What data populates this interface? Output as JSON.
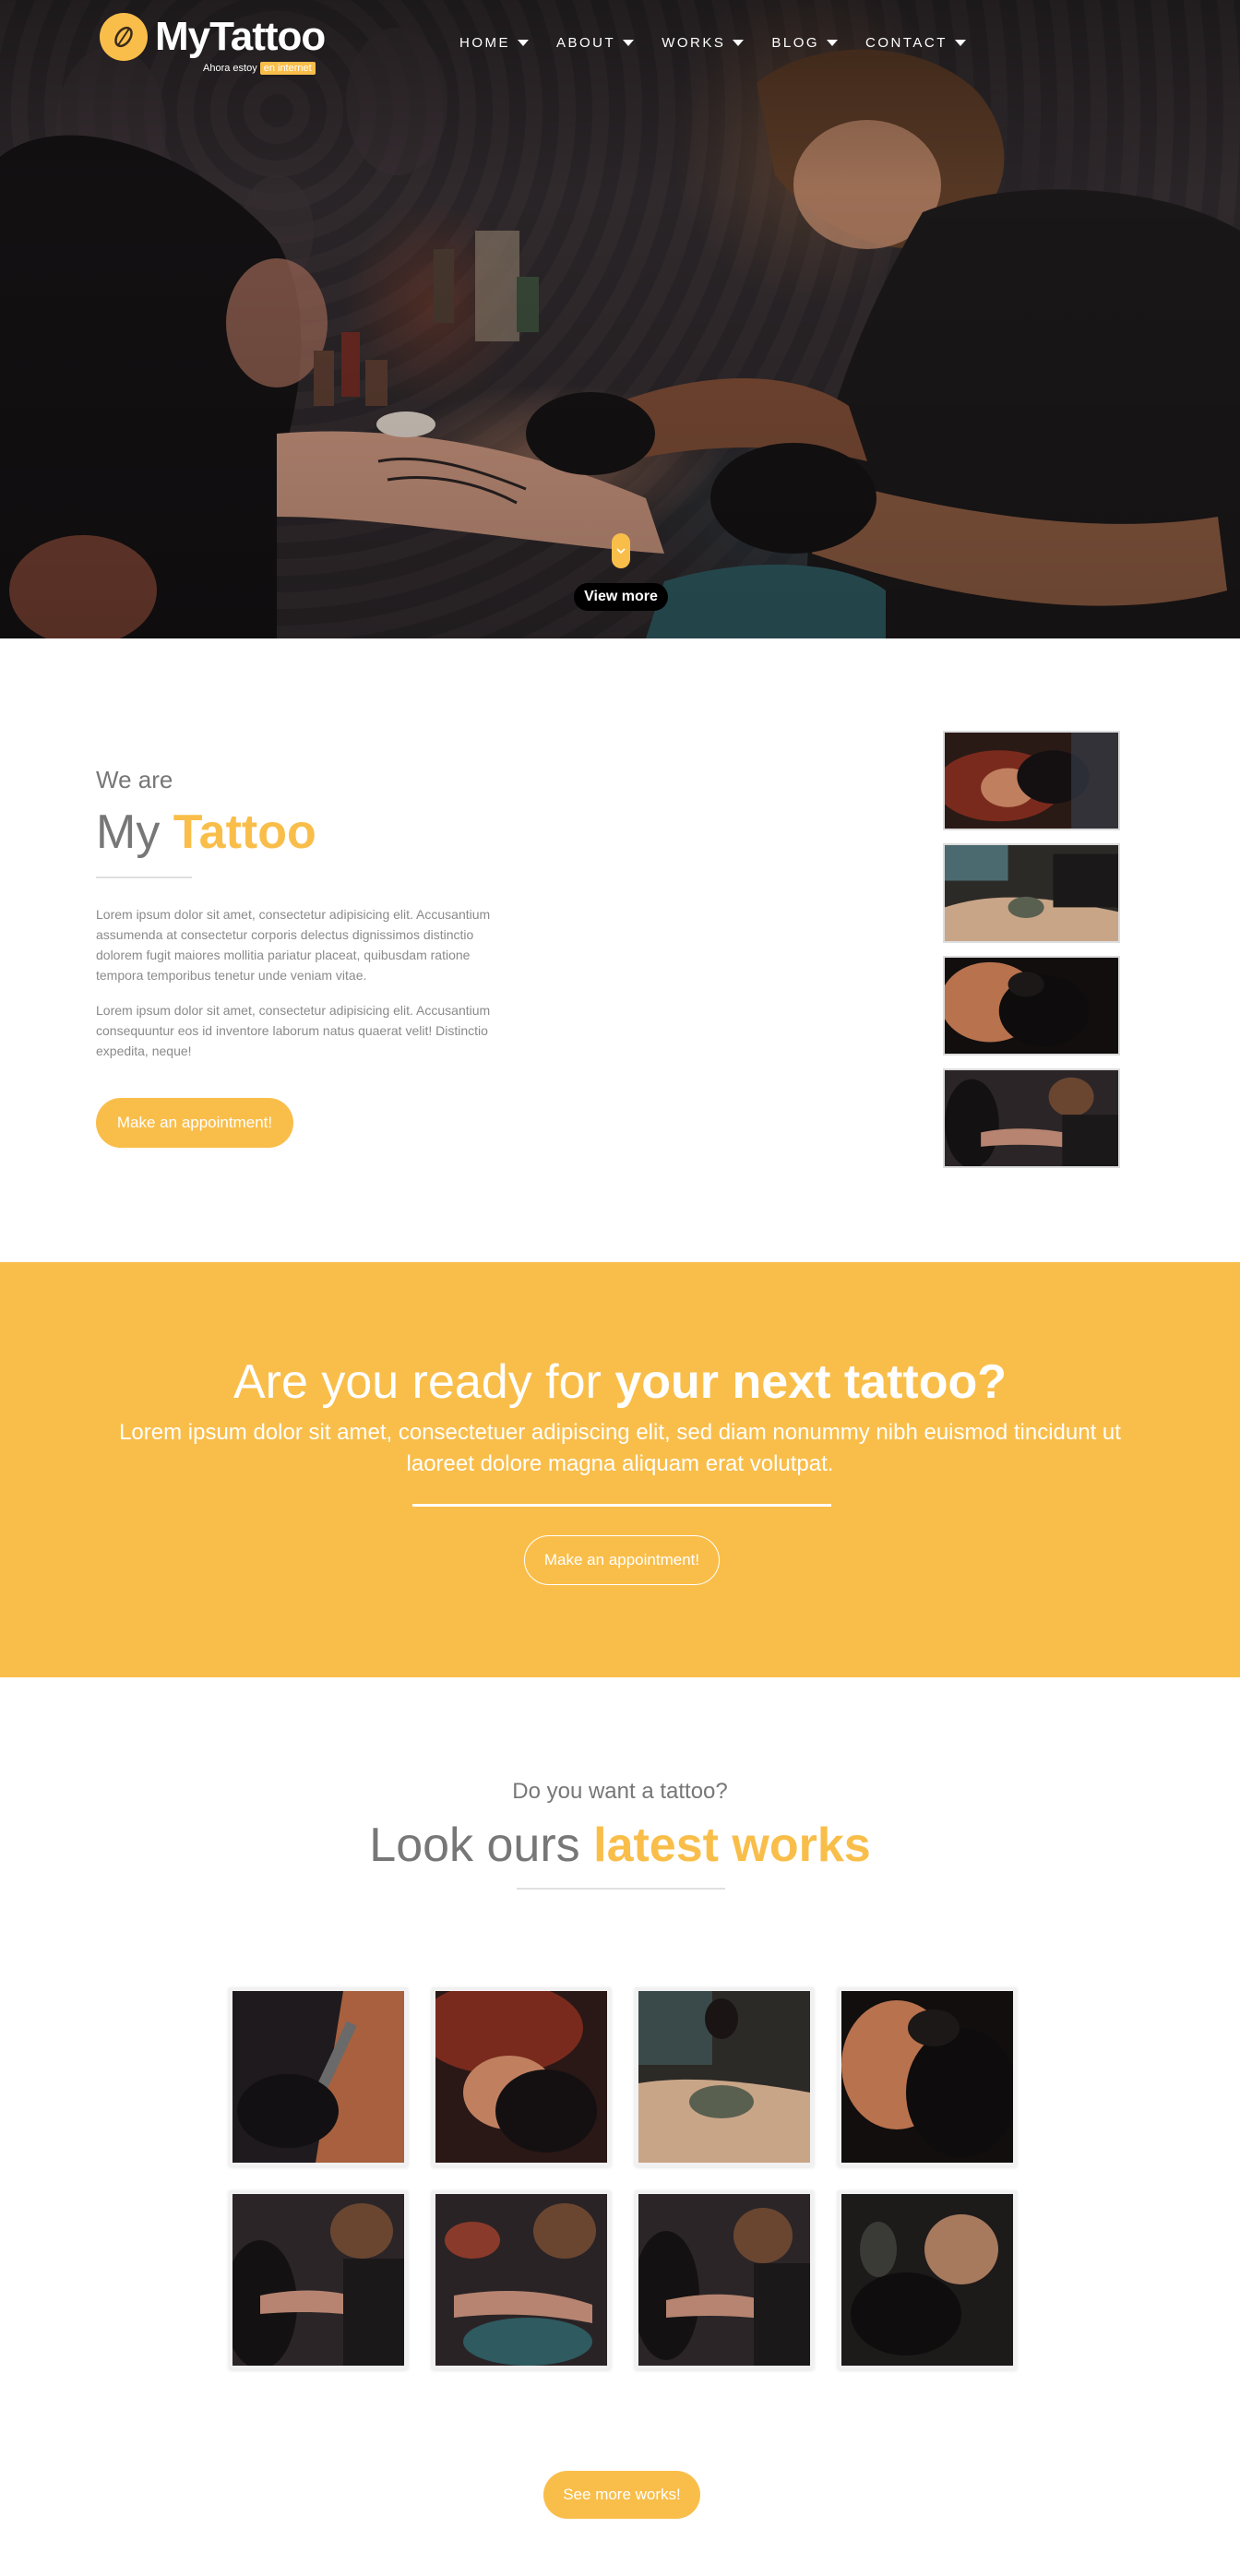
{
  "brand": {
    "name": "MyTattoo",
    "tagline_prefix": "Ahora estoy",
    "tagline_highlight": "en internet",
    "accent": "#f9be4a"
  },
  "nav": {
    "items": [
      {
        "label": "HOME"
      },
      {
        "label": "ABOUT"
      },
      {
        "label": "WORKS"
      },
      {
        "label": "BLOG"
      },
      {
        "label": "CONTACT"
      }
    ]
  },
  "hero": {
    "view_more": "View more",
    "scroll_icon": "chevron-down-icon"
  },
  "about": {
    "kicker": "We are",
    "title_plain": "My",
    "title_accent": "Tattoo",
    "paragraphs": [
      "Lorem ipsum dolor sit amet, consectetur adipisicing elit. Accusantium assumenda at consectetur corporis delectus dignissimos distinctio dolorem fugit maiores mollitia pariatur placeat, quibusdam ratione tempora temporibus tenetur unde veniam vitae.",
      "Lorem ipsum dolor sit amet, consectetur adipisicing elit. Accusantium consequuntur eos id inventore laborum natus quaerat velit! Distinctio expedita, neque!"
    ],
    "button": "Make an appointment!"
  },
  "cta": {
    "headline_plain": "Are you ready for",
    "headline_bold": "your next tattoo?",
    "sub": "Lorem ipsum dolor sit amet, consectetuer adipiscing elit, sed diam nonummy nibh euismod tincidunt ut laoreet dolore magna aliquam erat volutpat.",
    "button": "Make an appointment!",
    "background": "#f9be4a"
  },
  "works": {
    "kicker": "Do you want a tattoo?",
    "title_plain": "Look ours",
    "title_accent": "latest works",
    "button": "See more works!"
  }
}
